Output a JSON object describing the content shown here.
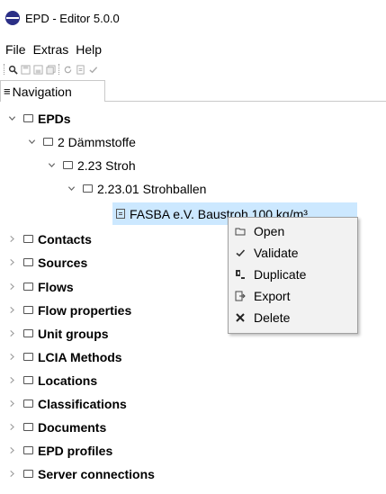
{
  "window": {
    "title": "EPD - Editor 5.0.0"
  },
  "menu": {
    "items": [
      "File",
      "Extras",
      "Help"
    ]
  },
  "nav_tab": {
    "label": "Navigation"
  },
  "tree": {
    "epds": "EPDs",
    "daemmstoffe": "2 Dämmstoffe",
    "stroh": "2.23 Stroh",
    "strohballen": "2.23.01 Strohballen",
    "dataset": "FASBA e.V. Baustroh 100 kg/m³",
    "roots": [
      "Contacts",
      "Sources",
      "Flows",
      "Flow properties",
      "Unit groups",
      "LCIA Methods",
      "Locations",
      "Classifications",
      "Documents",
      "EPD profiles",
      "Server connections"
    ]
  },
  "context_menu": {
    "items": [
      "Open",
      "Validate",
      "Duplicate",
      "Export",
      "Delete"
    ]
  },
  "colors": {
    "selection": "#cce8ff",
    "logo": "#2b2f86"
  }
}
